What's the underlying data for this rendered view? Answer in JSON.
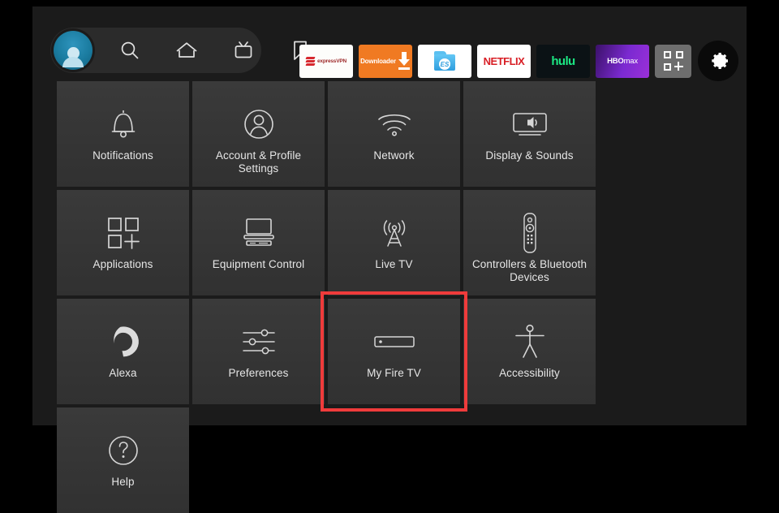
{
  "screen": {
    "device": "Fire TV",
    "accent_selected": "#ef3b3b",
    "tile_bg": "#373737",
    "background": "#1b1b1b"
  },
  "topbar": {
    "nav_items": [
      {
        "name": "profile-avatar",
        "label": "Profile",
        "icon": "avatar-icon"
      },
      {
        "name": "search",
        "label": "Search",
        "icon": "search-icon"
      },
      {
        "name": "home",
        "label": "Home",
        "icon": "home-icon"
      },
      {
        "name": "live-tv",
        "label": "Live TV",
        "icon": "tv-icon"
      },
      {
        "name": "watchlist",
        "label": "Watchlist",
        "icon": "bookmark-icon"
      }
    ],
    "apps": [
      {
        "name": "expressvpn",
        "label": "ExpressVPN",
        "short": "expressVPN",
        "bg": "#fdfdfb"
      },
      {
        "name": "downloader",
        "label": "Downloader",
        "short": "Downloader",
        "bg": "#f07a22"
      },
      {
        "name": "es-file-explorer",
        "label": "ES File Explorer",
        "short": "ES",
        "bg": "#ffffff"
      },
      {
        "name": "netflix",
        "label": "Netflix",
        "short": "NETFLIX",
        "bg": "#ffffff"
      },
      {
        "name": "hulu",
        "label": "Hulu",
        "short": "hulu",
        "bg": "#0b1215"
      },
      {
        "name": "hbo-max",
        "label": "HBO Max",
        "short": "HBOmax",
        "bg": "#7b2ad1"
      }
    ],
    "app_grid_label": "Apps",
    "settings_label": "Settings",
    "settings_selected": true
  },
  "settings_grid": {
    "selected_index": 10,
    "tiles": [
      {
        "label": "Notifications",
        "icon": "bell-icon"
      },
      {
        "label": "Account & Profile Settings",
        "icon": "person-circle-icon"
      },
      {
        "label": "Network",
        "icon": "wifi-icon"
      },
      {
        "label": "Display & Sounds",
        "icon": "display-speaker-icon"
      },
      {
        "label": "Applications",
        "icon": "app-grid-plus-icon"
      },
      {
        "label": "Equipment Control",
        "icon": "tv-soundbar-icon"
      },
      {
        "label": "Live TV",
        "icon": "broadcast-tower-icon"
      },
      {
        "label": "Controllers & Bluetooth Devices",
        "icon": "remote-control-icon"
      },
      {
        "label": "Alexa",
        "icon": "alexa-ring-icon"
      },
      {
        "label": "Preferences",
        "icon": "sliders-icon"
      },
      {
        "label": "My Fire TV",
        "icon": "fire-tv-stick-icon"
      },
      {
        "label": "Accessibility",
        "icon": "accessibility-person-icon"
      },
      {
        "label": "Help",
        "icon": "question-circle-icon"
      }
    ]
  }
}
